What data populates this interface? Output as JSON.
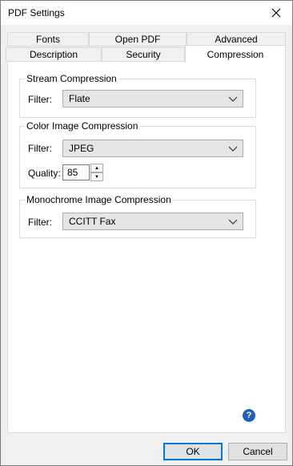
{
  "window": {
    "title": "PDF Settings"
  },
  "tabs": {
    "row_top": [
      "Fonts",
      "Open PDF",
      "Advanced"
    ],
    "row_bottom": [
      "Description",
      "Security",
      "Compression"
    ],
    "active": "Compression"
  },
  "stream": {
    "legend": "Stream Compression",
    "filter_label": "Filter:",
    "filter_value": "Flate"
  },
  "color": {
    "legend": "Color Image Compression",
    "filter_label": "Filter:",
    "filter_value": "JPEG",
    "quality_label": "Quality:",
    "quality_value": "85"
  },
  "mono": {
    "legend": "Monochrome Image Compression",
    "filter_label": "Filter:",
    "filter_value": "CCITT Fax"
  },
  "buttons": {
    "ok": "OK",
    "cancel": "Cancel"
  },
  "help_icon": "?",
  "colors": {
    "accent": "#0078d7",
    "help": "#1e5fb8"
  }
}
